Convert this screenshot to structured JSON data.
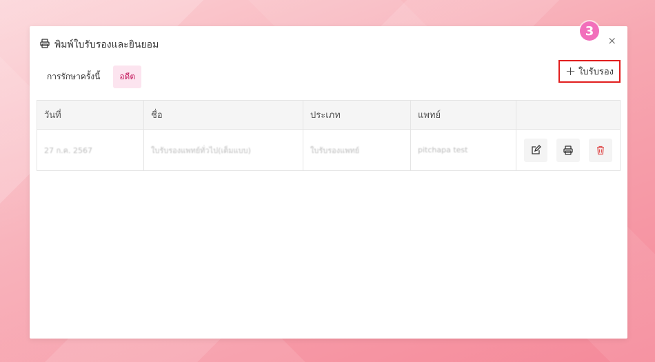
{
  "modal": {
    "title": "พิมพ์ใบรับรองและยินยอม",
    "close_glyph": "×"
  },
  "tabs": [
    {
      "label": "การรักษาครั้งนี้",
      "active": false
    },
    {
      "label": "อดีต",
      "active": true
    }
  ],
  "add_button": {
    "plus": "+",
    "label": "ใบรับรอง"
  },
  "step_badge": "3",
  "table": {
    "columns": [
      "วันที่",
      "ชื่อ",
      "ประเภท",
      "แพทย์",
      ""
    ],
    "rows": [
      {
        "date": "27 ก.ค. 2567",
        "name": "ใบรับรองแพทย์ทั่วไป(เต็มแบบ)",
        "type": "ใบรับรองแพทย์",
        "doctor": "pitchapa test"
      }
    ]
  },
  "colors": {
    "accent": "#c2185b",
    "highlight": "#e11d1d",
    "badge": "#f26fbb",
    "delete": "#e05454"
  },
  "icons": {
    "title": "printer-icon",
    "edit": "edit-icon",
    "print": "printer-icon",
    "delete": "trash-icon"
  }
}
